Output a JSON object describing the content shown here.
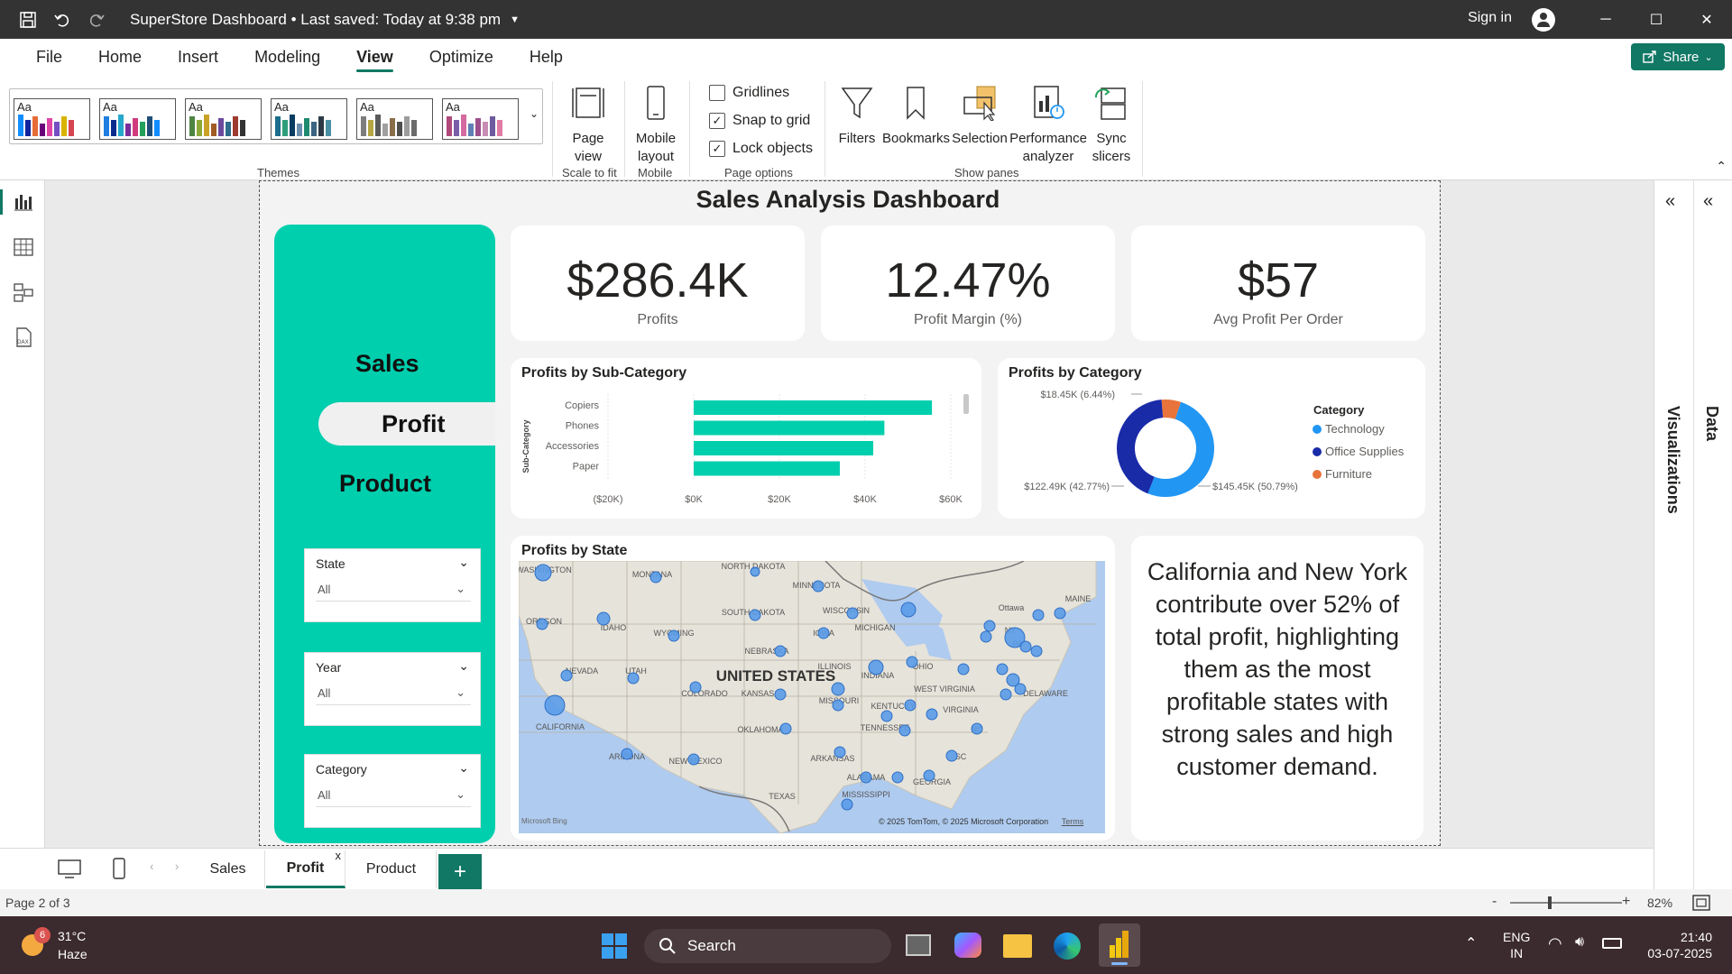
{
  "app": {
    "title": "SuperStore Dashboard • Last saved: Today at 9:38 pm",
    "sign_in": "Sign in"
  },
  "menu": {
    "items": [
      "File",
      "Home",
      "Insert",
      "Modeling",
      "View",
      "Optimize",
      "Help"
    ],
    "active": "View",
    "share": "Share"
  },
  "ribbon": {
    "themes_label": "Themes",
    "page_view": "Page view",
    "scale_to_fit": "Scale to fit",
    "mobile_layout": "Mobile layout",
    "mobile": "Mobile",
    "gridlines": "Gridlines",
    "snap_to_grid": "Snap to grid",
    "lock_objects": "Lock objects",
    "page_options": "Page options",
    "filters": "Filters",
    "bookmarks": "Bookmarks",
    "selection": "Selection",
    "performance_analyzer": "Performance analyzer",
    "sync_slicers": "Sync slicers",
    "show_panes": "Show panes",
    "checks": {
      "gridlines": false,
      "snap_to_grid": true,
      "lock_objects": true
    }
  },
  "dashboard": {
    "title": "Sales Analysis Dashboard",
    "nav": {
      "sales": "Sales",
      "profit": "Profit",
      "product": "Product"
    },
    "slicers": [
      {
        "title": "State",
        "value": "All"
      },
      {
        "title": "Year",
        "value": "All"
      },
      {
        "title": "Category",
        "value": "All"
      }
    ],
    "kpis": [
      {
        "value": "$286.4K",
        "label": "Profits"
      },
      {
        "value": "12.47%",
        "label": "Profit Margin (%)"
      },
      {
        "value": "$57",
        "label": "Avg Profit Per Order"
      }
    ],
    "map": {
      "title": "Profits by State",
      "country_label": "UNITED STATES",
      "footer": "© 2025 TomTom, © 2025 Microsoft Corporation",
      "terms": "Terms",
      "bing": "Microsoft Bing",
      "state_labels": [
        "WASHINGTON",
        "MONTANA",
        "NORTH DAKOTA",
        "MINNESOTA",
        "OREGON",
        "IDAHO",
        "SOUTH DAKOTA",
        "WISCONSIN",
        "MICHIGAN",
        "WYOMING",
        "IOWA",
        "NEVADA",
        "NEBRASKA",
        "UTAH",
        "COLORADO",
        "KANSAS",
        "ILLINOIS",
        "INDIANA",
        "OHIO",
        "CALIFORNIA",
        "MISSOURI",
        "KENTUCKY",
        "WEST VIRGINIA",
        "VIRGINIA",
        "OKLAHOMA",
        "TENNESSEE",
        "NC",
        "ARIZONA",
        "NEW MEXICO",
        "ARKANSAS",
        "ALABAMA",
        "GEORGIA",
        "SC",
        "MISSISSIPPI",
        "TEXAS",
        "NY",
        "PA",
        "DELAWARE",
        "MAINE",
        "Ottawa"
      ]
    },
    "insight": "California and New York contribute over 52% of total profit, highlighting them as the most profitable states with strong sales and high customer demand."
  },
  "chart_data": [
    {
      "type": "bar",
      "title": "Profits by Sub-Category",
      "ylabel": "Sub-Category",
      "categories": [
        "Copiers",
        "Phones",
        "Accessories",
        "Paper"
      ],
      "values": [
        55.6,
        44.5,
        41.9,
        34.1
      ],
      "unit": "$K",
      "xlim": [
        -20,
        60
      ],
      "x_ticks": [
        "($20K)",
        "$0K",
        "$20K",
        "$40K",
        "$60K"
      ],
      "color": "#00CFAE"
    },
    {
      "type": "pie",
      "title": "Profits by Category",
      "legend_title": "Category",
      "categories": [
        "Technology",
        "Office Supplies",
        "Furniture"
      ],
      "values": [
        145.45,
        122.49,
        18.45
      ],
      "labels": [
        "$145.45K (50.79%)",
        "$122.49K (42.77%)",
        "$18.45K (6.44%)"
      ],
      "colors": [
        "#2196F3",
        "#1A2BA8",
        "#E8743B"
      ],
      "donut": true
    }
  ],
  "pages": {
    "tabs": [
      "Sales",
      "Profit",
      "Product"
    ],
    "active": "Profit",
    "close": "x",
    "add": "+",
    "page_indicator": "Page 2 of 3"
  },
  "right_pane": {
    "visualizations": "Visualizations",
    "data": "Data"
  },
  "status": {
    "zoom": "82%",
    "minus": "-",
    "plus": "+"
  },
  "taskbar": {
    "weather_temp": "31°C",
    "weather_desc": "Haze",
    "weather_badge": "6",
    "search": "Search",
    "lang1": "ENG",
    "lang2": "IN",
    "time": "21:40",
    "date": "03-07-2025"
  }
}
